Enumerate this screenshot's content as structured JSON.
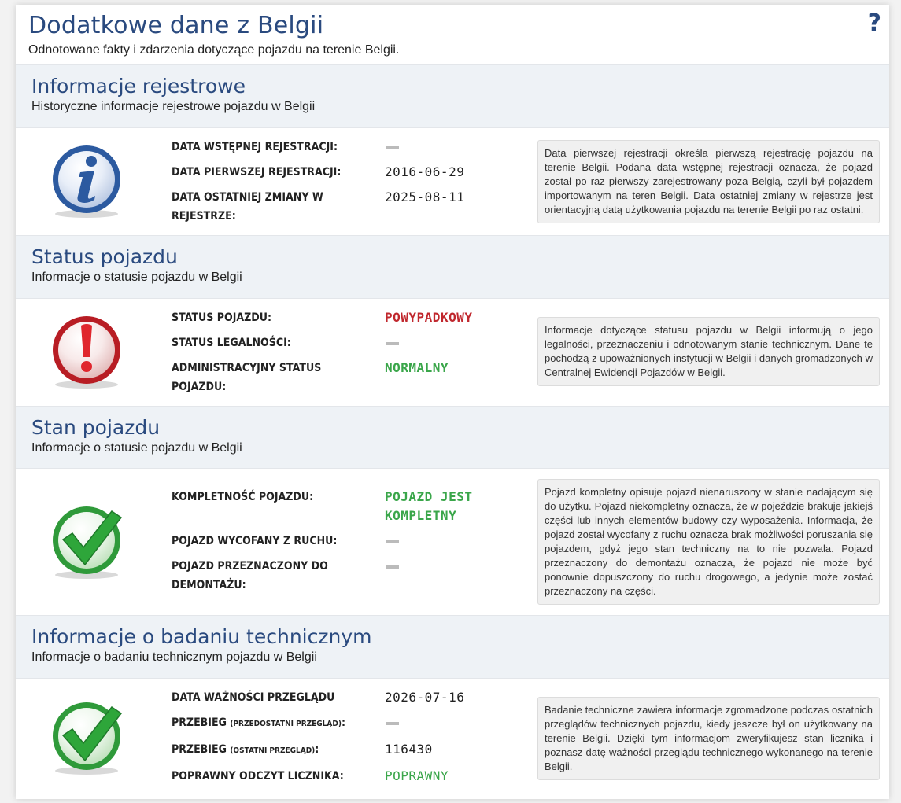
{
  "header": {
    "title": "Dodatkowe dane z Belgii",
    "subtitle": "Odnotowane fakty i zdarzenia dotyczące pojazdu na terenie Belgii.",
    "help": "?"
  },
  "sections": [
    {
      "title": "Informacje rejestrowe",
      "subtitle": "Historyczne informacje rejestrowe pojazdu w Belgii",
      "icon": "info-icon",
      "rows": [
        {
          "label": "DATA WSTĘPNEJ REJESTRACJI:",
          "value": ""
        },
        {
          "label": "DATA PIERWSZEJ REJESTRACJI:",
          "value": "2016-06-29"
        },
        {
          "label": "DATA OSTATNIEJ ZMIANY W REJESTRZE:",
          "value": "2025-08-11"
        }
      ],
      "note": "Data pierwszej rejestracji określa pierwszą rejestrację pojazdu na terenie Belgii. Podana data wstępnej rejestracji oznacza, że pojazd został po raz pierwszy zarejestrowany poza Belgią, czyli był pojazdem importowanym na teren Belgii. Data ostatniej zmiany w rejestrze jest orientacyjną datą użytkowania pojazdu na terenie Belgii po raz ostatni."
    },
    {
      "title": "Status pojazdu",
      "subtitle": "Informacje o statusie pojazdu w Belgii",
      "icon": "exclamation-icon",
      "rows": [
        {
          "label": "STATUS POJAZDU:",
          "value": "POWYPADKOWY"
        },
        {
          "label": "STATUS LEGALNOŚCI:",
          "value": ""
        },
        {
          "label": "ADMINISTRACYJNY STATUS POJAZDU:",
          "value": "NORMALNY"
        }
      ],
      "note": "Informacje dotyczące statusu pojazdu w Belgii informują o jego legalności, przeznaczeniu i odnotowanym stanie technicznym. Dane te pochodzą z upoważnionych instytucji w Belgii i danych gromadzonych w Centralnej Ewidencji Pojazdów w Belgii."
    },
    {
      "title": "Stan pojazdu",
      "subtitle": "Informacje o statusie pojazdu w Belgii",
      "icon": "checkmark-icon",
      "rows": [
        {
          "label": "KOMPLETNOŚĆ POJAZDU:",
          "value": "POJAZD JEST KOMPLETNY"
        },
        {
          "label": "POJAZD WYCOFANY Z RUCHU:",
          "value": ""
        },
        {
          "label": "POJAZD PRZEZNACZONY DO DEMONTAŻU:",
          "value": ""
        }
      ],
      "note": "Pojazd kompletny opisuje pojazd nienaruszony w stanie nadającym się do użytku. Pojazd niekompletny oznacza, że w pojeździe brakuje jakiejś części lub innych elementów budowy czy wyposażenia. Informacja, że pojazd został wycofany z ruchu oznacza brak możliwości poruszania się pojazdem, gdyż jego stan techniczny na to nie pozwala. Pojazd przeznaczony do demontażu oznacza, że pojazd nie może być ponownie dopuszczony do ruchu drogowego, a jedynie może zostać przeznaczony na części."
    },
    {
      "title": "Informacje o badaniu technicznym",
      "subtitle": "Informacje o badaniu technicznym pojazdu w Belgii",
      "icon": "checkmark-icon",
      "rows": [
        {
          "label": "DATA WAŻNOŚCI PRZEGLĄDU",
          "value": "2026-07-16"
        },
        {
          "label": "PRZEBIEG",
          "label_small": "(PRZEDOSTATNI PRZEGLĄD)",
          "label_suffix": ":",
          "value": ""
        },
        {
          "label": "PRZEBIEG",
          "label_small": "(OSTATNI PRZEGLĄD)",
          "label_suffix": ":",
          "value": "116430"
        },
        {
          "label": "POPRAWNY ODCZYT LICZNIKA:",
          "value": "POPRAWNY"
        }
      ],
      "note": "Badanie techniczne zawiera informacje zgromadzone podczas ostatnich przeglądów technicznych pojazdu, kiedy jeszcze był on użytkowany na terenie Belgii. Dzięki tym informacjom zweryfikujesz stan licznika i poznasz datę ważności przeglądu technicznego wykonanego na terenie Belgii."
    }
  ],
  "colors": {
    "title": "#2a4a7f",
    "alert": "#c0272d",
    "ok": "#3aa64a"
  }
}
